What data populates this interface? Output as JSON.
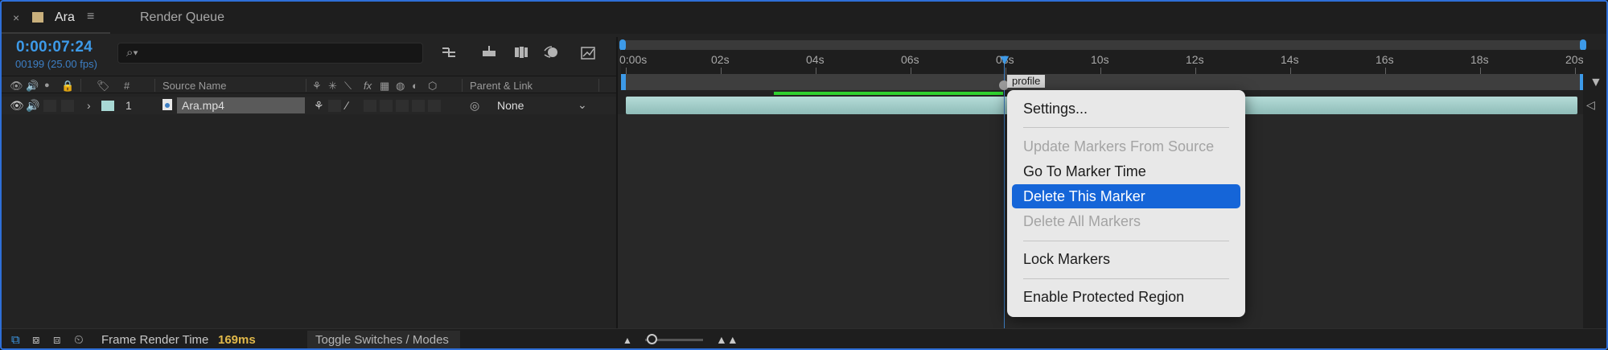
{
  "tabs": {
    "close_glyph": "×",
    "active_tab": "Ara",
    "menu_glyph": "≡",
    "other_tab": "Render Queue"
  },
  "composition": {
    "timecode": "0:00:07:24",
    "frame_info": "00199 (25.00 fps)",
    "search_value": ""
  },
  "columns": {
    "number": "#",
    "source_name": "Source Name",
    "fx": "fx",
    "parent_link": "Parent & Link"
  },
  "layer": {
    "expand_glyph": "›",
    "number": "1",
    "name": "Ara.mp4",
    "parent": "None",
    "label_color": "#a8d8d4"
  },
  "ruler": {
    "ticks": [
      "0:00s",
      "02s",
      "04s",
      "06s",
      "08s",
      "10s",
      "12s",
      "14s",
      "16s",
      "18s",
      "20s"
    ]
  },
  "marker": {
    "label": "profile"
  },
  "context_menu": {
    "items": [
      {
        "label": "Settings...",
        "state": "normal"
      },
      {
        "label": "Update Markers From Source",
        "state": "disabled"
      },
      {
        "label": "Go To Marker Time",
        "state": "normal"
      },
      {
        "label": "Delete This Marker",
        "state": "highlighted"
      },
      {
        "label": "Delete All Markers",
        "state": "disabled"
      },
      {
        "label": "Lock Markers",
        "state": "normal"
      },
      {
        "label": "Enable Protected Region",
        "state": "normal"
      }
    ]
  },
  "footer": {
    "frame_render_label": "Frame Render Time",
    "frame_render_value": "169ms",
    "toggle_label": "Toggle Switches / Modes"
  },
  "colors": {
    "accent": "#3d9ae8",
    "menu_highlight": "#1565d8",
    "work_area": "#2fd12f",
    "render_time": "#e0b84a"
  }
}
